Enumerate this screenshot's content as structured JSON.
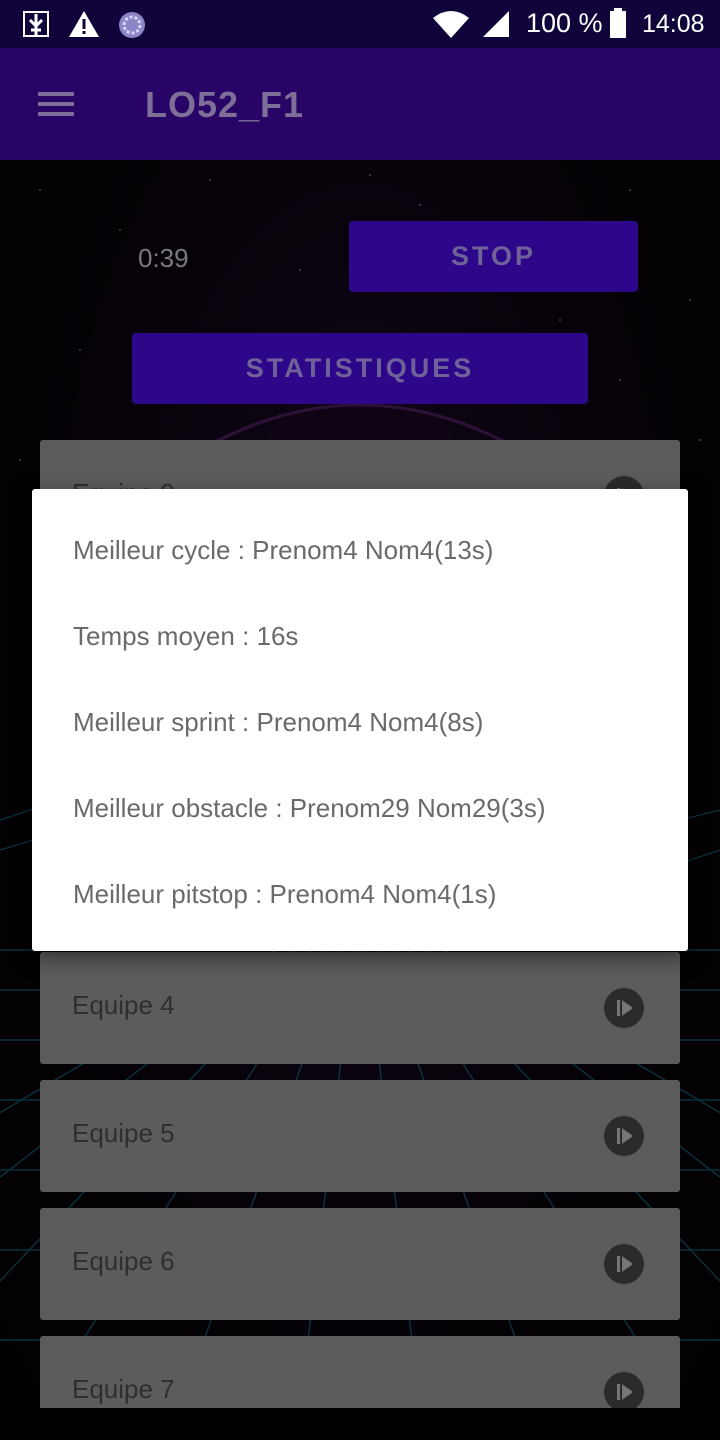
{
  "status_bar": {
    "icons": [
      "usb-debug-icon",
      "warning-icon",
      "sync-circle-icon",
      "wifi-icon",
      "signal-icon",
      "battery-icon"
    ],
    "battery": "100 %",
    "time": "14:08"
  },
  "app_bar": {
    "menu_icon": "hamburger-menu-icon",
    "title": "LO52_F1"
  },
  "controls": {
    "timer": "0:39",
    "stop_label": "STOP",
    "stats_label": "STATISTIQUES"
  },
  "teams": [
    {
      "label": "Equipe 0"
    },
    {
      "label": "Equipe 4"
    },
    {
      "label": "Equipe 5"
    },
    {
      "label": "Equipe 6"
    },
    {
      "label": "Equipe 7"
    }
  ],
  "dialog": {
    "lines": [
      "Meilleur cycle : Prenom4 Nom4(13s)",
      "Temps moyen : 16s",
      "Meilleur sprint : Prenom4 Nom4(8s)",
      "Meilleur obstacle : Prenom29 Nom29(3s)",
      "Meilleur pitstop : Prenom4 Nom4(1s)"
    ]
  },
  "colors": {
    "status_bar_bg": "#10043a",
    "app_bar_bg": "#270466",
    "button_bg": "#2c078a",
    "card_bg": "#5c5c5c",
    "dialog_bg": "#ffffff",
    "grid_line": "#1fa3c8"
  }
}
